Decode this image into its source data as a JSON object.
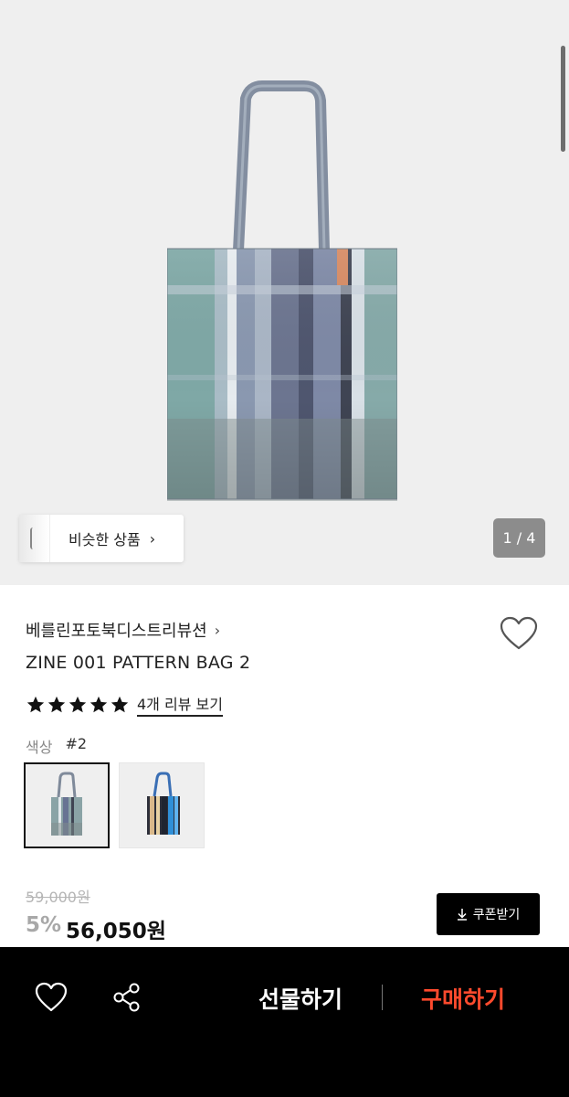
{
  "gallery": {
    "similar_label": "비슷한 상품",
    "similar_chevron": "›",
    "counter": "1 / 4"
  },
  "product": {
    "brand": "베를린포토북디스트리뷰션",
    "brand_chevron": "›",
    "name": "ZINE 001 PATTERN BAG 2",
    "rating_stars": 5,
    "review_link": "4개 리뷰 보기",
    "color_label": "색상",
    "color_value": "#2",
    "original_price": "59,000원",
    "discount_rate": "5%",
    "final_price": "56,050원",
    "coupon_label": "쿠폰받기"
  },
  "bottom_bar": {
    "gift_label": "선물하기",
    "buy_label": "구매하기"
  },
  "colors": {
    "buy_accent": "#ff4a2d",
    "bottom_bar_bg": "#000000",
    "gallery_bg": "#efefef"
  },
  "icons": {
    "wishlist": "heart-icon",
    "share": "share-icon",
    "coupon": "download-icon",
    "star": "star-icon"
  }
}
